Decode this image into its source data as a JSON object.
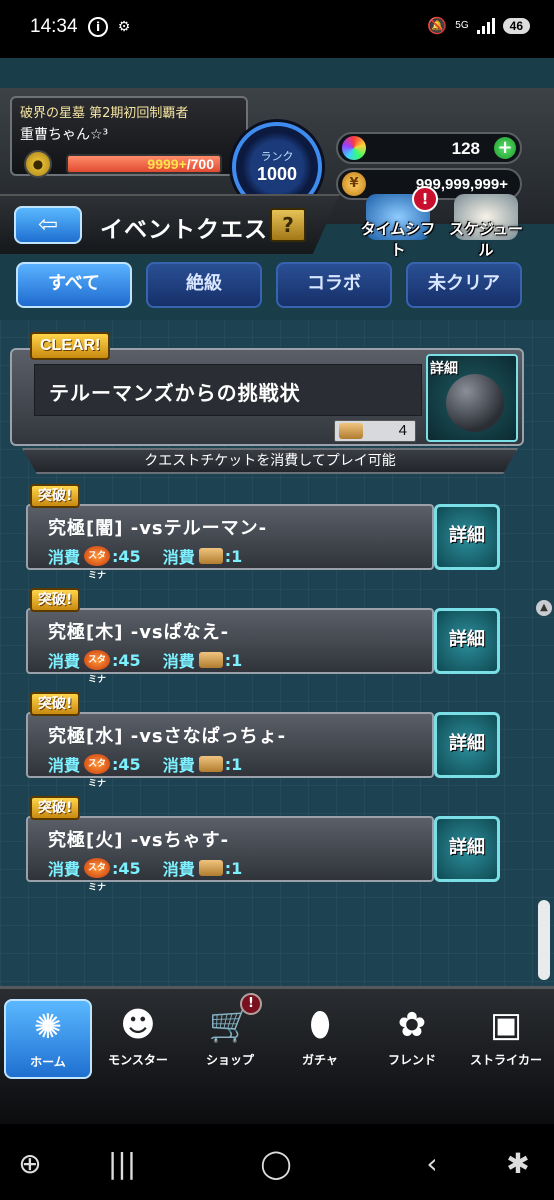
{
  "status_bar": {
    "time": "14:34",
    "network": "5G",
    "battery": "46"
  },
  "player": {
    "title": "破界の星墓 第2期初回制覇者",
    "name": "重曹ちゃん☆³",
    "stamina_current": "9999+",
    "stamina_max": "/700",
    "rank_label": "ランク",
    "rank_value": "1000",
    "orbs": "128",
    "gold": "999,999,999+"
  },
  "header": {
    "page_title": "イベントクエスト",
    "help_label": "?",
    "timeshift_label": "タイムシフト",
    "timeshift_alert": "!",
    "schedule_label": "スケジュール"
  },
  "tabs": [
    {
      "label": "すべて"
    },
    {
      "label": "絶級"
    },
    {
      "label": "コラボ"
    },
    {
      "label": "未クリア"
    }
  ],
  "event": {
    "clear_badge": "CLEAR!",
    "name": "テルーマンズからの挑戦状",
    "ticket_count": "4",
    "detail_tag": "詳細",
    "info_text": "クエストチケットを消費してプレイ可能"
  },
  "quests": [
    {
      "badge": "突破!",
      "name": "究極[闇] -vsテルーマン-",
      "cost_label": "消費",
      "stamina_cost": ":45",
      "ticket_cost": ":1",
      "detail": "詳細"
    },
    {
      "badge": "突破!",
      "name": "究極[木] -vsぱなえ-",
      "cost_label": "消費",
      "stamina_cost": ":45",
      "ticket_cost": ":1",
      "detail": "詳細"
    },
    {
      "badge": "突破!",
      "name": "究極[水] -vsさなぱっちょ-",
      "cost_label": "消費",
      "stamina_cost": ":45",
      "ticket_cost": ":1",
      "detail": "詳細"
    },
    {
      "badge": "突破!",
      "name": "究極[火] -vsちゃす-",
      "cost_label": "消費",
      "stamina_cost": ":45",
      "ticket_cost": ":1",
      "detail": "詳細"
    }
  ],
  "stamina_icon_text": "スタミナ",
  "bottom_nav": {
    "badge": "!",
    "items": [
      {
        "label": "ホーム",
        "icon": "home-icon"
      },
      {
        "label": "モンスター",
        "icon": "monster-icon"
      },
      {
        "label": "ショップ",
        "icon": "cart-icon"
      },
      {
        "label": "ガチャ",
        "icon": "egg-icon"
      },
      {
        "label": "フレンド",
        "icon": "friends-icon"
      },
      {
        "label": "ストライカー",
        "icon": "striker-card-icon"
      }
    ]
  },
  "colors": {
    "accent_blue": "#1f6fd0",
    "detail_teal": "#7adfe6",
    "gold": "#ffd54a",
    "cost_cyan": "#7cf0ff"
  }
}
